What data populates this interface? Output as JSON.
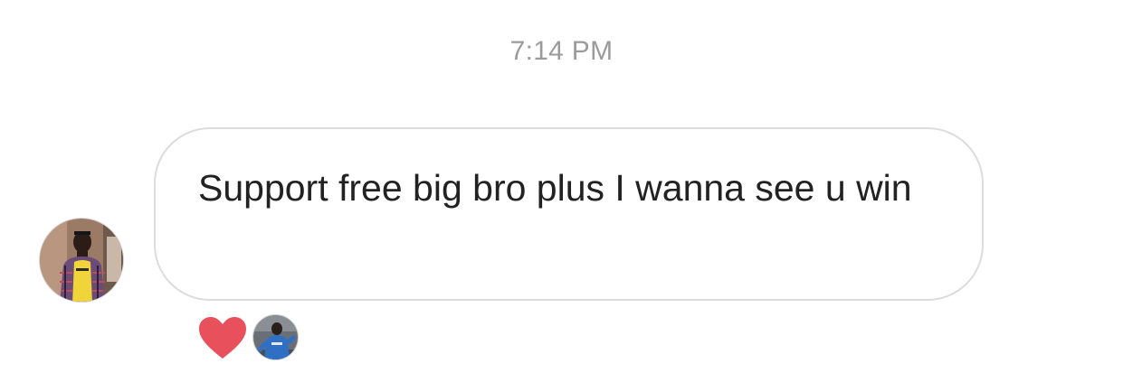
{
  "thread": {
    "timestamp": "7:14 PM"
  },
  "message": {
    "text": "Support free big bro plus I wanna see u win",
    "sender_avatar": "user-photo-avatar"
  },
  "reactions": {
    "icon": "heart-icon",
    "color": "#e8505b",
    "reactor_avatar": "user-photo-avatar"
  },
  "colors": {
    "timestamp": "#9b9b9b",
    "bubble_border": "#dcdcdc",
    "message_text": "#222222"
  }
}
